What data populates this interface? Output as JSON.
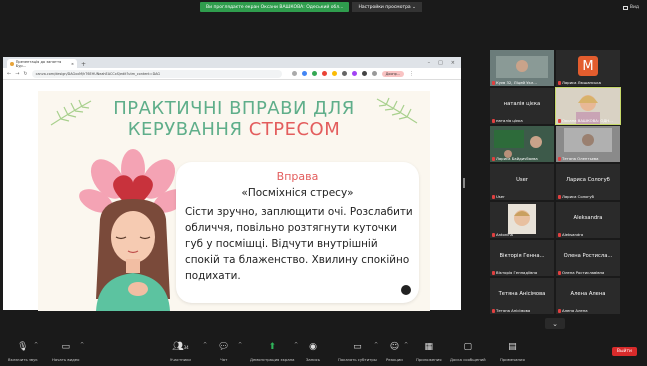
{
  "banner": {
    "recording_text": "Ви проглядаєте екран Оксани ВАШКОВА: Одеський обл...",
    "settings_text": "Настройки просмотра",
    "view_label": "Вид"
  },
  "browser": {
    "tab_title": "Презентація до заняття Бур...",
    "url": "canva.com/design/DAGxxM/hT6EHUNeahEACCxS/edit?utm_content=DAG",
    "user_label": "Доопр..."
  },
  "slide": {
    "title_line1": "ПРАКТИЧНІ ВПРАВИ ДЛЯ",
    "title_line2_a": "КЕРУВАННЯ ",
    "title_line2_b": "СТРЕСОМ",
    "card_heading": "Вправа",
    "card_subheading": "«Посміхніся стресу»",
    "card_body": "Сісти зручно, заплющити очі. Розслабити обличчя, повільно розтягнути куточки губ у посмішці. Відчути внутрішній спокій та блаженство. Хвилину спокійно подихати."
  },
  "participants": [
    {
      "name": "Куєв 32, Ліцей Укл...",
      "center": "",
      "kind": "video-grey"
    },
    {
      "name": "Лариса Люшанська",
      "center": "",
      "kind": "avatar-m"
    },
    {
      "name": "наталія цієка",
      "center": "наталія цієка",
      "kind": "name"
    },
    {
      "name": "Оксана ВАШКОВА: ОДН...",
      "center": "",
      "kind": "video-active"
    },
    {
      "name": "Лариса Байдичбаєва",
      "center": "",
      "kind": "video-class"
    },
    {
      "name": "Тетяна Олентьєва",
      "center": "",
      "kind": "video-grey2"
    },
    {
      "name": "User",
      "center": "User",
      "kind": "name"
    },
    {
      "name": "Лариса Сологуб",
      "center": "Лариса Сологуб",
      "kind": "name"
    },
    {
      "name": "Antonina",
      "center": "",
      "kind": "video-face"
    },
    {
      "name": "Aleksandra",
      "center": "Aleksandra",
      "kind": "name"
    },
    {
      "name": "Вікторія Геннадіївна",
      "center": "Вікторія Генна...",
      "kind": "name"
    },
    {
      "name": "Олена Ростиславівна",
      "center": "Олена Ростисла...",
      "kind": "name"
    },
    {
      "name": "Тетяна Анісімова",
      "center": "Тетяна Анісімова",
      "kind": "name"
    },
    {
      "name": "Алена Алена",
      "center": "Алена Алена",
      "kind": "name"
    }
  ],
  "avatar_letter": "M",
  "toolbar": {
    "mute": "Включить звук",
    "video": "Начать видео",
    "participants": "Участники",
    "participants_count": "34",
    "chat": "Чат",
    "share": "Демонстрация экрана",
    "record": "Запись",
    "captions": "Показать субтитры",
    "reactions": "Реакции",
    "apps": "Приложения",
    "whiteboards": "Доска сообщений",
    "notes": "Примечания",
    "leave": "Выйти"
  },
  "colors": {
    "slide_green": "#5fae8a",
    "slide_red": "#e35d5d",
    "leave_red": "#d92b2b",
    "active_border": "#c7d96a"
  }
}
